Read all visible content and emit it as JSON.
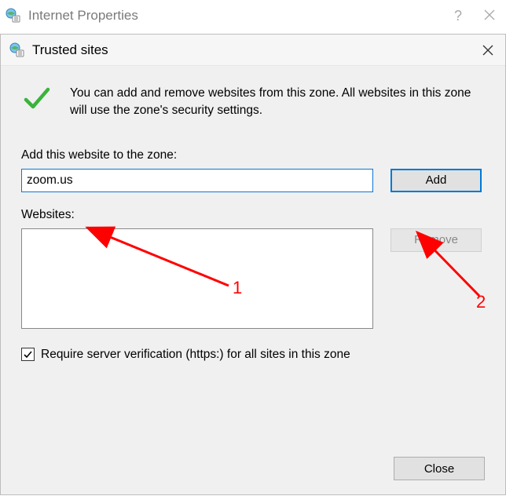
{
  "outer": {
    "title": "Internet Properties"
  },
  "dialog": {
    "title": "Trusted sites",
    "info_text": "You can add and remove websites from this zone. All websites in this zone will use the zone's security settings.",
    "add_label": "Add this website to the zone:",
    "input_value": "zoom.us",
    "add_button": "Add",
    "websites_label": "Websites:",
    "remove_button": "Remove",
    "checkbox_label": "Require server verification (https:) for all sites in this zone",
    "checkbox_checked": true,
    "close_button": "Close"
  },
  "annotations": {
    "num1": "1",
    "num2": "2"
  }
}
